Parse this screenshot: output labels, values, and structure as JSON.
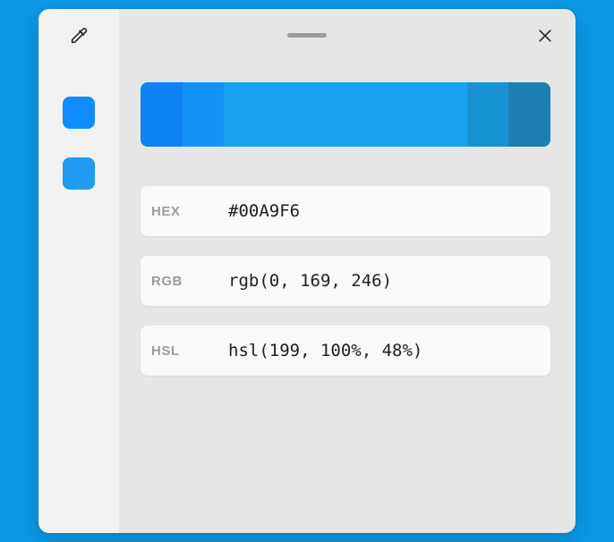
{
  "desktop_bg": "#0b99e6",
  "sidebar_swatches": [
    {
      "color": "#0f8cff"
    },
    {
      "color": "#1f9bf0"
    }
  ],
  "shades": [
    {
      "color": "#0f82f5",
      "flex": 1.0
    },
    {
      "color": "#1493fb",
      "flex": 1.0
    },
    {
      "color": "#19a2ee",
      "flex": 5.8
    },
    {
      "color": "#1793d3",
      "flex": 1.0
    },
    {
      "color": "#1d7fb4",
      "flex": 1.0
    }
  ],
  "rows": {
    "hex": {
      "label": "HEX",
      "value": "#00A9F6"
    },
    "rgb": {
      "label": "RGB",
      "value": "rgb(0, 169, 246)"
    },
    "hsl": {
      "label": "HSL",
      "value": "hsl(199, 100%, 48%)"
    }
  }
}
